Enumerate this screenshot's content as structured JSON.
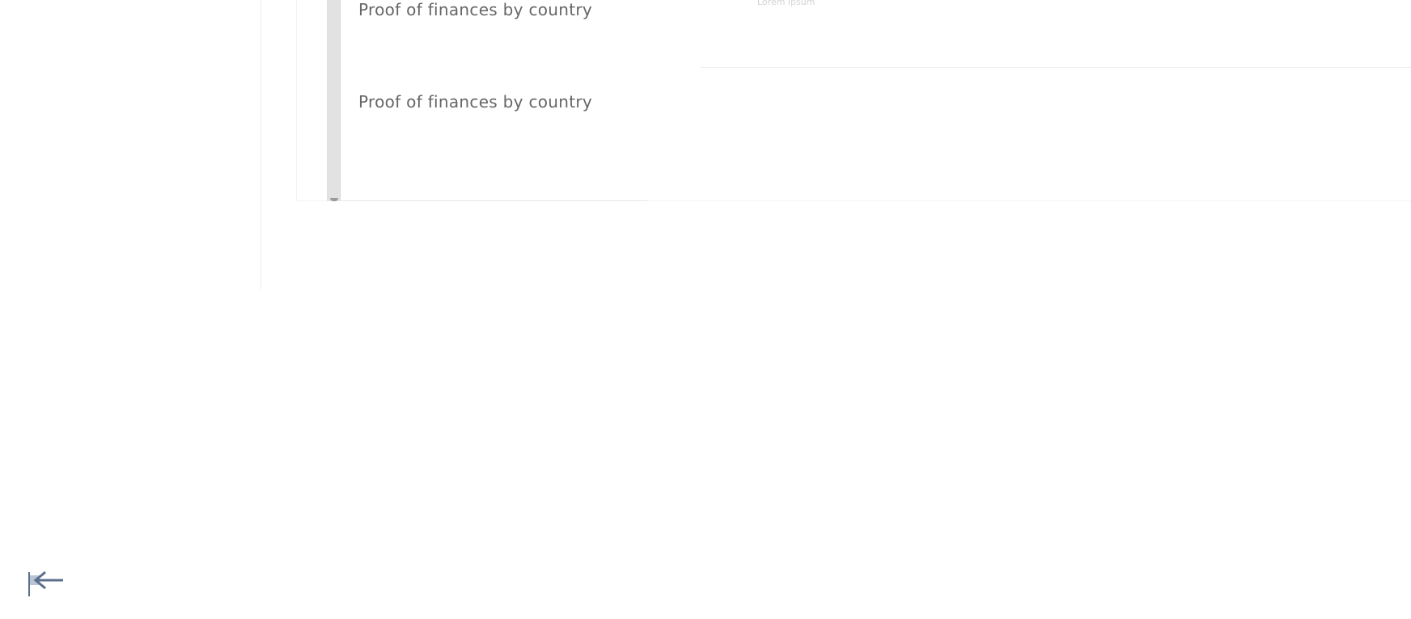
{
  "dropdown": {
    "items": [
      {
        "label": "Proof of finances by country"
      },
      {
        "label": "Proof of finances by country"
      }
    ]
  },
  "content": {
    "faded_caption": "Lorem ipsum"
  },
  "sidebar": {
    "collapse_icon": "collapse-left-arrow-icon"
  }
}
